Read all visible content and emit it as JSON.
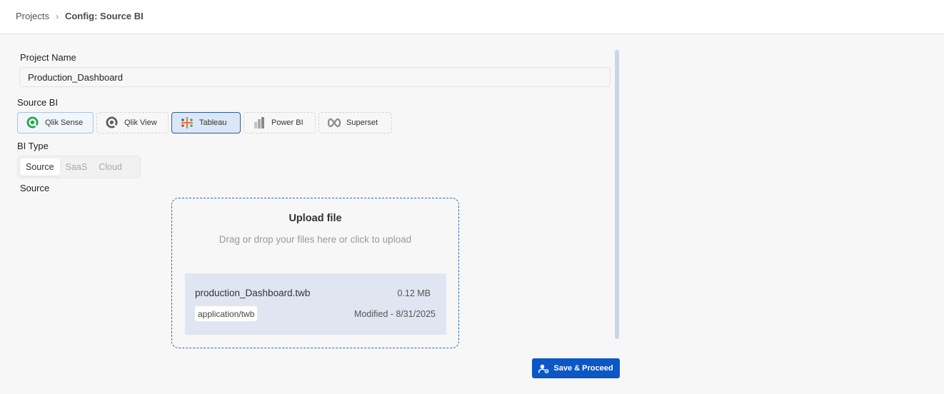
{
  "breadcrumb": {
    "parent": "Projects",
    "separator": "›",
    "current": "Config: Source BI"
  },
  "project_name": {
    "label": "Project Name",
    "value": "Production_Dashboard"
  },
  "source_bi": {
    "label": "Source BI",
    "options": [
      {
        "label": "Qlik Sense",
        "icon": "qlik-sense-icon",
        "state": "selected"
      },
      {
        "label": "Qlik View",
        "icon": "qlik-view-icon",
        "state": "default"
      },
      {
        "label": "Tableau",
        "icon": "tableau-icon",
        "state": "active"
      },
      {
        "label": "Power BI",
        "icon": "power-bi-icon",
        "state": "default"
      },
      {
        "label": "Superset",
        "icon": "superset-icon",
        "state": "default"
      }
    ]
  },
  "bi_type": {
    "label": "BI Type",
    "options": [
      "Source",
      "SaaS",
      "Cloud"
    ],
    "selected": "Source"
  },
  "source": {
    "label": "Source",
    "upload": {
      "title": "Upload file",
      "subtitle": "Drag or drop your files here or click to upload"
    },
    "file": {
      "name": "production_Dashboard.twb",
      "size": "0.12 MB",
      "mime": "application/twb",
      "modified": "Modified - 8/31/2025"
    }
  },
  "actions": {
    "save_label": "Save & Proceed",
    "save_icon": "user-settings-icon"
  },
  "colors": {
    "primary": "#0b57c7",
    "qlik_green": "#1fa848",
    "selected_border": "#2b5aa3",
    "upload_border": "#2b66b5",
    "file_card_bg": "#dfe6f1"
  }
}
